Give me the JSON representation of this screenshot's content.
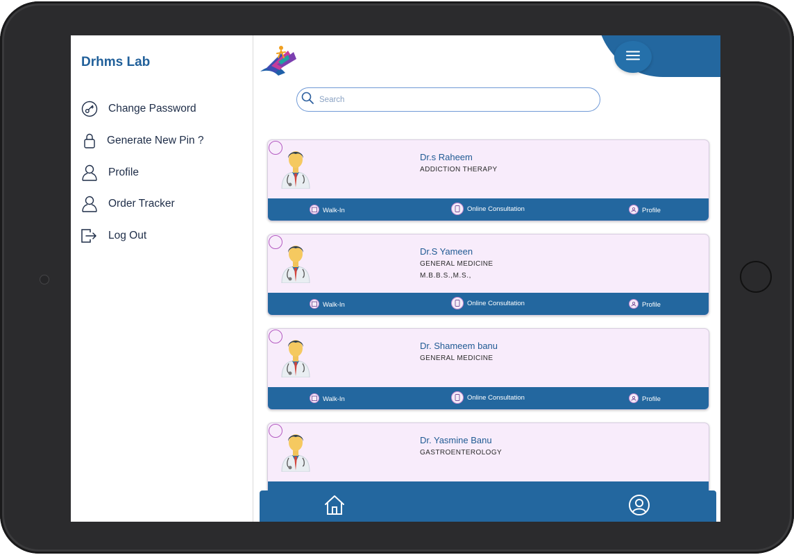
{
  "app": {
    "title": "Drhms Lab"
  },
  "drawer": {
    "items": [
      {
        "label": "Change Password",
        "icon": "key-icon"
      },
      {
        "label": "Generate New Pin ?",
        "icon": "lock-icon"
      },
      {
        "label": "Profile",
        "icon": "user-icon"
      },
      {
        "label": "Order Tracker",
        "icon": "user-icon"
      },
      {
        "label": "Log Out",
        "icon": "logout-icon"
      }
    ]
  },
  "search": {
    "placeholder": "Search"
  },
  "actions": {
    "walkin": "Walk-In",
    "online": "Online Consultation",
    "profile": "Profile"
  },
  "doctors": [
    {
      "name": "Dr.s Raheem",
      "specialty": "ADDICTION THERAPY",
      "qualification": ""
    },
    {
      "name": "Dr.S Yameen",
      "specialty": "GENERAL MEDICINE",
      "qualification": "M.B.B.S.,M.S.,"
    },
    {
      "name": "Dr. Shameem banu",
      "specialty": "GENERAL MEDICINE",
      "qualification": ""
    },
    {
      "name": "Dr. Yasmine Banu",
      "specialty": "GASTROENTEROLOGY",
      "qualification": ""
    }
  ],
  "colors": {
    "primary": "#23679f",
    "card_bg": "#f8ecfb",
    "accent": "#b35ac1",
    "title": "#21609a"
  }
}
